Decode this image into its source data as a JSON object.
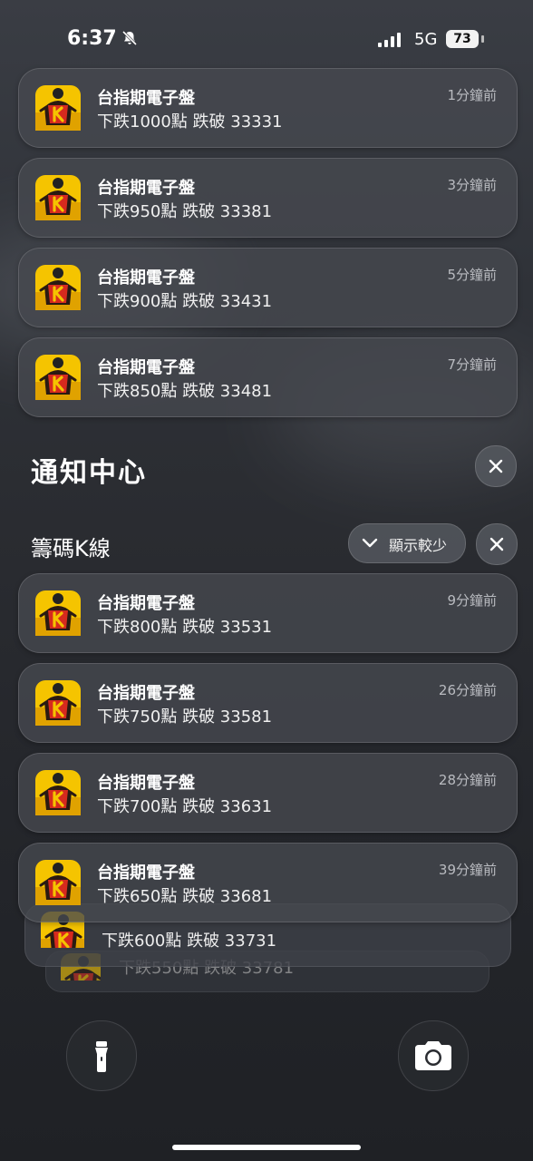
{
  "status_bar": {
    "time": "6:37",
    "network": "5G",
    "battery": "73"
  },
  "app_icon": "k-line-app-icon",
  "notifications_top": [
    {
      "title": "台指期電子盤",
      "body": "下跌1000點 跌破 33331",
      "time": "1分鐘前"
    },
    {
      "title": "台指期電子盤",
      "body": "下跌950點 跌破 33381",
      "time": "3分鐘前"
    },
    {
      "title": "台指期電子盤",
      "body": "下跌900點 跌破 33431",
      "time": "5分鐘前"
    },
    {
      "title": "台指期電子盤",
      "body": "下跌850點 跌破 33481",
      "time": "7分鐘前"
    }
  ],
  "notification_center": {
    "title": "通知中心"
  },
  "group": {
    "name": "籌碼K線",
    "show_less_label": "顯示較少",
    "items": [
      {
        "title": "台指期電子盤",
        "body": "下跌800點 跌破 33531",
        "time": "9分鐘前"
      },
      {
        "title": "台指期電子盤",
        "body": "下跌750點 跌破 33581",
        "time": "26分鐘前"
      },
      {
        "title": "台指期電子盤",
        "body": "下跌700點 跌破 33631",
        "time": "28分鐘前"
      },
      {
        "title": "台指期電子盤",
        "body": "下跌650點 跌破 33681",
        "time": "39分鐘前"
      }
    ],
    "stacked": [
      {
        "body": "下跌600點 跌破 33731"
      },
      {
        "body": "下跌550點 跌破 33781"
      }
    ]
  },
  "quick_actions": {
    "left": "flashlight-icon",
    "right": "camera-icon"
  },
  "colors": {
    "icon_yellow": "#f5c400",
    "icon_red": "#d62a1e"
  }
}
